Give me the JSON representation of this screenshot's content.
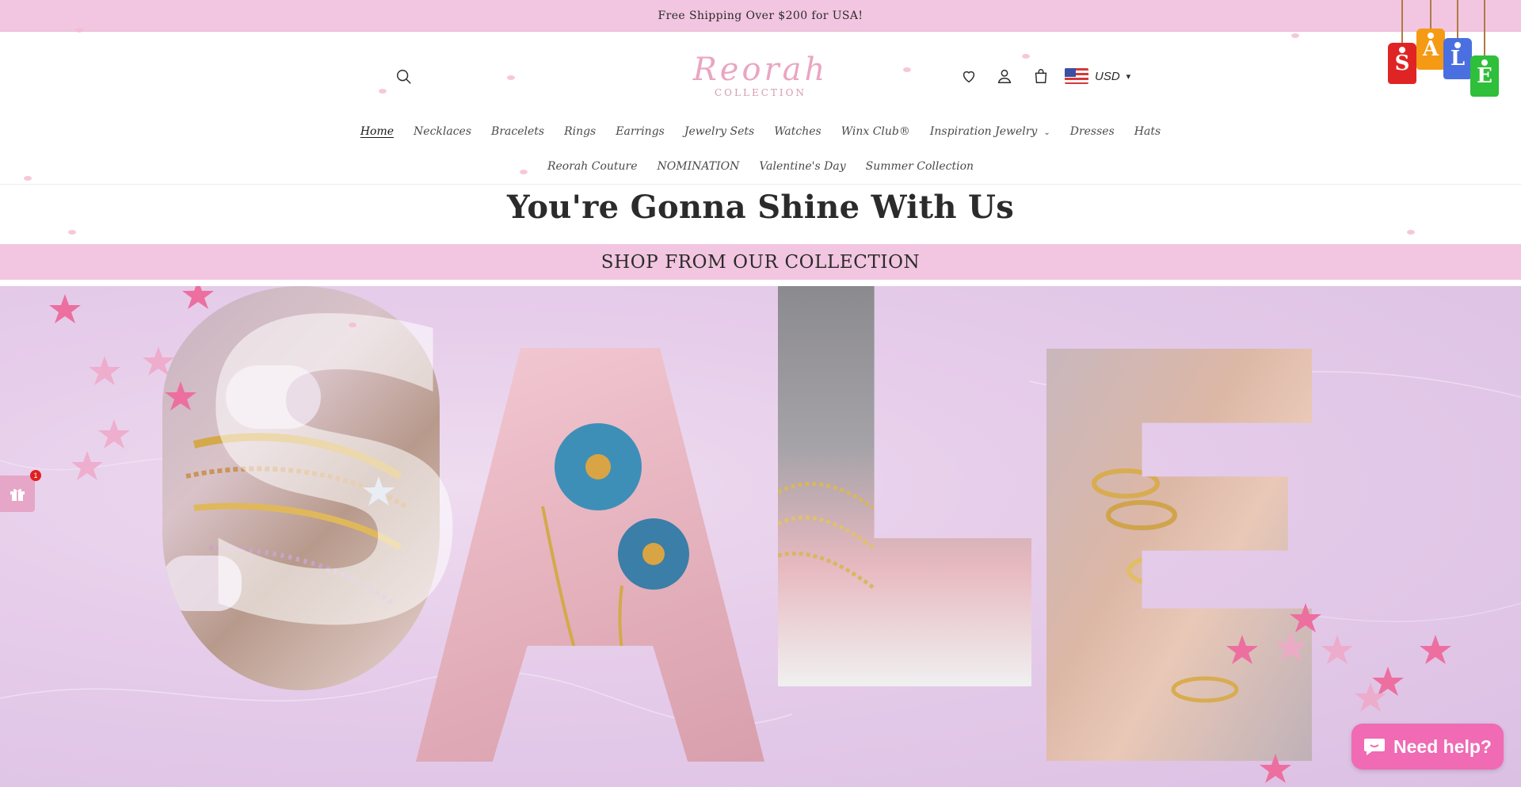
{
  "announcement": {
    "text": "Free Shipping Over $200 for USA!"
  },
  "header": {
    "logo_script": "Reorah",
    "logo_sub": "COLLECTION",
    "currency": {
      "code": "USD",
      "flag": "us-flag-icon"
    },
    "icons": [
      "search-icon",
      "heart-icon",
      "account-icon",
      "cart-icon"
    ]
  },
  "nav": {
    "row1": [
      {
        "label": "Home",
        "active": true
      },
      {
        "label": "Necklaces"
      },
      {
        "label": "Bracelets"
      },
      {
        "label": "Rings"
      },
      {
        "label": "Earrings"
      },
      {
        "label": "Jewelry Sets"
      },
      {
        "label": "Watches"
      },
      {
        "label": "Winx Club®"
      },
      {
        "label": "Inspiration Jewelry",
        "dropdown": true
      },
      {
        "label": "Dresses"
      },
      {
        "label": "Hats"
      }
    ],
    "row2": [
      {
        "label": "Reorah Couture"
      },
      {
        "label": "NOMINATION"
      },
      {
        "label": "Valentine's Day"
      },
      {
        "label": "Summer Collection"
      }
    ]
  },
  "hero": {
    "title": "You're Gonna Shine With Us",
    "collection_bar": "SHOP FROM OUR COLLECTION"
  },
  "banner": {
    "letters": [
      "S",
      "A",
      "L",
      "E"
    ],
    "image_desc_icons": [
      "bracelets-photo",
      "flower-charm-photo",
      "chain-bracelets-photo",
      "rings-hand-photo"
    ]
  },
  "sale_tags": {
    "letters": [
      "S",
      "A",
      "L",
      "E"
    ],
    "colors": [
      "#e02424",
      "#f59a14",
      "#4a6fe0",
      "#2fbf3a"
    ]
  },
  "widgets": {
    "gift_badge": "1",
    "chat_label": "Need help?"
  },
  "colors": {
    "accent_pink": "#f2c6e0",
    "chat_pink": "#f06ab4"
  }
}
